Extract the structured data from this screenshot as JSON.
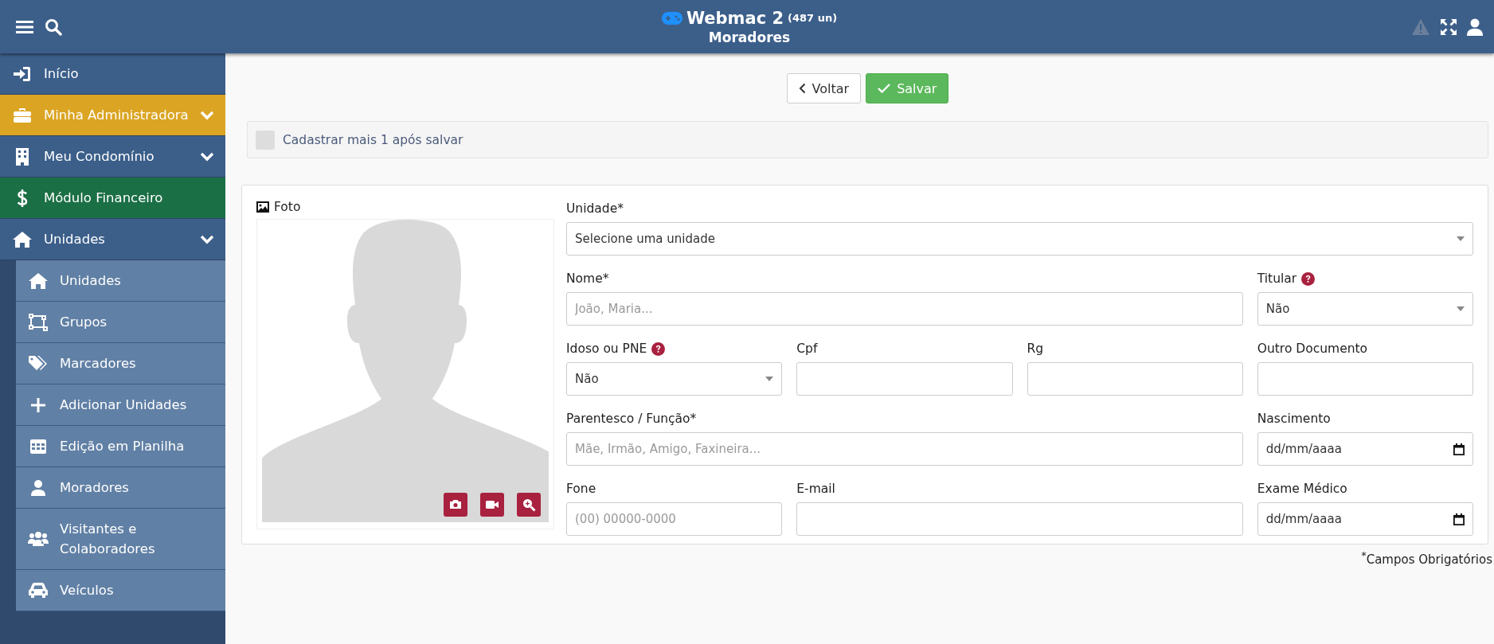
{
  "header": {
    "title": "Webmac 2",
    "count": "(487 un)",
    "subtitle": "Moradores"
  },
  "sidebar": {
    "items": [
      {
        "label": "Início",
        "kind": "link",
        "color": "#3c5f8a"
      },
      {
        "label": "Minha Administradora",
        "kind": "group",
        "color": "#dba523"
      },
      {
        "label": "Meu Condomínio",
        "kind": "group",
        "color": "#3c5f8a"
      },
      {
        "label": "Módulo Financeiro",
        "kind": "link",
        "color": "#1b6f45"
      },
      {
        "label": "Unidades",
        "kind": "group",
        "color": "#3c5f8a",
        "children": [
          {
            "label": "Unidades"
          },
          {
            "label": "Grupos"
          },
          {
            "label": "Marcadores"
          },
          {
            "label": "Adicionar Unidades"
          },
          {
            "label": "Edição em Planilha"
          },
          {
            "label": "Moradores"
          },
          {
            "label": "Visitantes e Colaboradores"
          },
          {
            "label": "Veículos"
          }
        ]
      }
    ]
  },
  "toolbar": {
    "buttons": [
      {
        "label": "Voltar",
        "kind": "back"
      },
      {
        "label": "Salvar",
        "kind": "save"
      }
    ]
  },
  "options": {
    "label": "Cadastrar mais 1 após salvar",
    "checked": false
  },
  "form": {
    "photo_label": "Foto",
    "fields": [
      {
        "label": "Unidade*",
        "kind": "select",
        "value": "Selecione uma unidade"
      },
      {
        "label": "Nome*",
        "kind": "text",
        "placeholder": "João, Maria..."
      },
      {
        "label": "Titular",
        "help": true,
        "kind": "select",
        "value": "Não"
      },
      {
        "label": "Idoso ou PNE",
        "help": true,
        "kind": "select",
        "value": "Não"
      },
      {
        "label": "Cpf",
        "kind": "text"
      },
      {
        "label": "Rg",
        "kind": "text"
      },
      {
        "label": "Outro Documento",
        "kind": "text"
      },
      {
        "label": "Parentesco / Função*",
        "kind": "text",
        "placeholder": "Mãe, Irmão, Amigo, Faxineira..."
      },
      {
        "label": "Nascimento",
        "kind": "date",
        "value": "dd/mm/aaaa"
      },
      {
        "label": "Fone",
        "kind": "text",
        "placeholder": "(00) 00000-0000"
      },
      {
        "label": "E-mail",
        "kind": "text"
      },
      {
        "label": "Exame Médico",
        "kind": "date",
        "value": "dd/mm/aaaa"
      }
    ],
    "note": "$^{*}$Campos Obrigatórios"
  }
}
